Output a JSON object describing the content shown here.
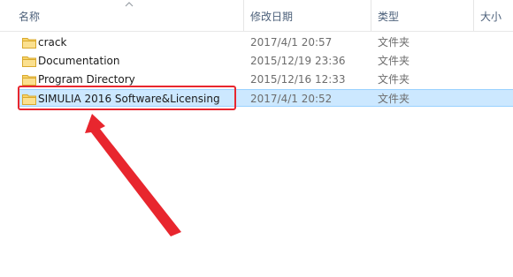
{
  "columns": {
    "name": "名称",
    "date": "修改日期",
    "type": "类型",
    "size": "大小"
  },
  "files": [
    {
      "name": "crack",
      "date": "2017/4/1 20:57",
      "type": "文件夹"
    },
    {
      "name": "Documentation",
      "date": "2015/12/19 23:36",
      "type": "文件夹"
    },
    {
      "name": "Program Directory",
      "date": "2015/12/16 12:33",
      "type": "文件夹"
    },
    {
      "name": "SIMULIA 2016 Software&Licensing",
      "date": "2017/4/1 20:52",
      "type": "文件夹",
      "selected": true
    }
  ],
  "colors": {
    "selection": "#cce8ff",
    "annotation": "#e8262e",
    "folder": "#f7d46a"
  }
}
